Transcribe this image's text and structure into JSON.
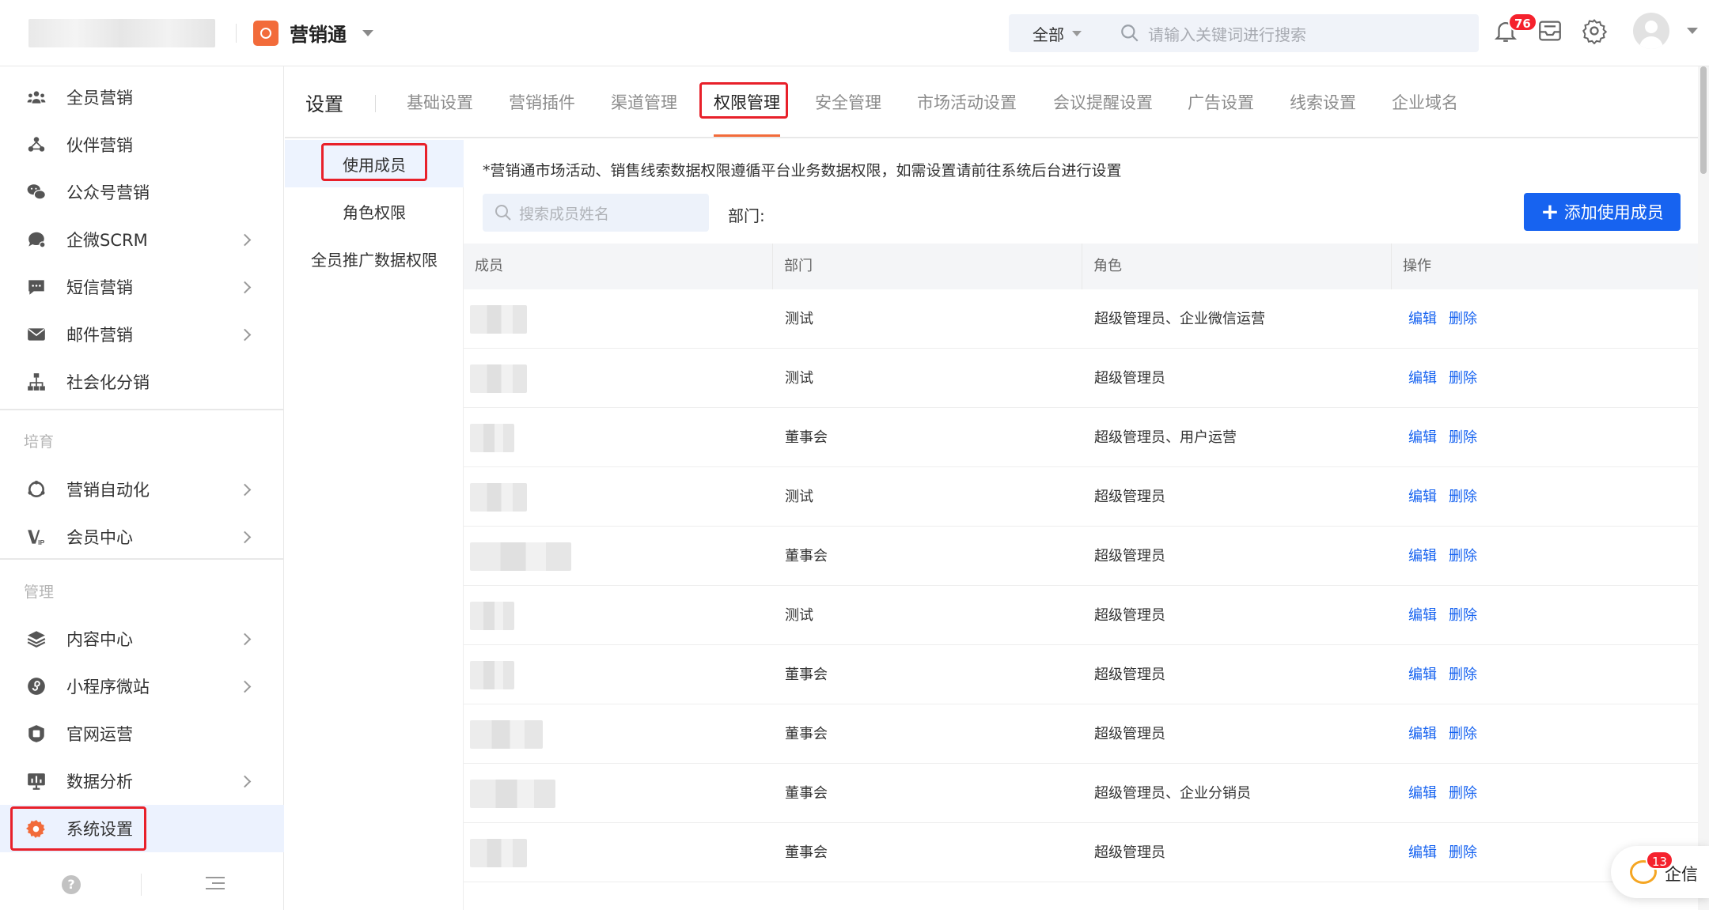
{
  "colors": {
    "accent": "#1763f0",
    "brand": "#f26b3a",
    "highlight": "#e8202a",
    "badge": "#f5222d"
  },
  "header": {
    "product_name": "营销通",
    "search_scope": "全部",
    "search_placeholder": "请输入关键词进行搜索",
    "notification_count": "76",
    "icons": [
      "bell-icon",
      "inbox-icon",
      "gear-icon",
      "avatar"
    ]
  },
  "sidebar": {
    "items": [
      {
        "label": "全员营销",
        "icon": "group-icon",
        "chevron": false
      },
      {
        "label": "伙伴营销",
        "icon": "partner-icon",
        "chevron": false
      },
      {
        "label": "公众号营销",
        "icon": "wechat-icon",
        "chevron": false
      },
      {
        "label": "企微SCRM",
        "icon": "chat-bubble-icon",
        "chevron": true
      },
      {
        "label": "短信营销",
        "icon": "sms-icon",
        "chevron": true
      },
      {
        "label": "邮件营销",
        "icon": "mail-icon",
        "chevron": true
      },
      {
        "label": "社会化分销",
        "icon": "org-tree-icon",
        "chevron": false
      }
    ],
    "section_nurture": "培育",
    "nurture_items": [
      {
        "label": "营销自动化",
        "icon": "automation-icon",
        "chevron": true
      },
      {
        "label": "会员中心",
        "icon": "vip-icon",
        "chevron": true
      }
    ],
    "section_manage": "管理",
    "manage_items": [
      {
        "label": "内容中心",
        "icon": "layers-icon",
        "chevron": true
      },
      {
        "label": "小程序微站",
        "icon": "miniprogram-icon",
        "chevron": true
      },
      {
        "label": "官网运营",
        "icon": "website-icon",
        "chevron": false
      },
      {
        "label": "数据分析",
        "icon": "monitor-chart-icon",
        "chevron": true
      },
      {
        "label": "系统设置",
        "icon": "settings-gear-icon",
        "chevron": false,
        "active": true
      }
    ]
  },
  "tabs": {
    "title": "设置",
    "items": [
      "基础设置",
      "营销插件",
      "渠道管理",
      "权限管理",
      "安全管理",
      "市场活动设置",
      "会议提醒设置",
      "广告设置",
      "线索设置",
      "企业域名"
    ],
    "active": "权限管理"
  },
  "subnav": {
    "items": [
      "使用成员",
      "角色权限",
      "全员推广数据权限"
    ],
    "active": "使用成员"
  },
  "content": {
    "notice": "*营销通市场活动、销售线索数据权限遵循平台业务数据权限，如需设置请前往系统后台进行设置",
    "member_search_placeholder": "搜索成员姓名",
    "dept_label": "部门:",
    "add_button": "添加使用成员",
    "columns": [
      "成员",
      "部门",
      "角色",
      "操作"
    ],
    "rows": [
      {
        "dept": "测试",
        "role": "超级管理员、企业微信运营"
      },
      {
        "dept": "测试",
        "role": "超级管理员"
      },
      {
        "dept": "董事会",
        "role": "超级管理员、用户运营"
      },
      {
        "dept": "测试",
        "role": "超级管理员"
      },
      {
        "dept": "董事会",
        "role": "超级管理员"
      },
      {
        "dept": "测试",
        "role": "超级管理员"
      },
      {
        "dept": "董事会",
        "role": "超级管理员"
      },
      {
        "dept": "董事会",
        "role": "超级管理员"
      },
      {
        "dept": "董事会",
        "role": "超级管理员、企业分销员"
      },
      {
        "dept": "董事会",
        "role": "超级管理员"
      }
    ],
    "edit_label": "编辑",
    "delete_label": "删除"
  },
  "chat": {
    "label": "企信",
    "count": "13"
  }
}
